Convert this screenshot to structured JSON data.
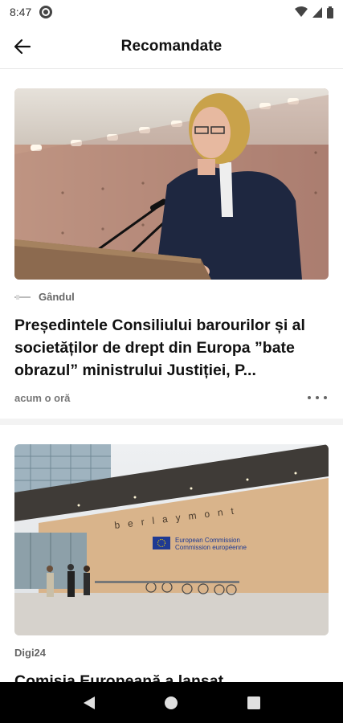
{
  "status_bar": {
    "time": "8:47",
    "icons": [
      "app-notification-icon",
      "wifi-icon",
      "cell-signal-icon",
      "battery-icon"
    ]
  },
  "header": {
    "title": "Recomandate",
    "back_icon": "arrow-left-icon"
  },
  "articles": [
    {
      "source": "Gândul",
      "headline": "Președintele Consiliului barourilor și al societăților de drept din Europa ”bate obrazul” ministrului Justiției, P...",
      "time_ago": "acum o oră",
      "image_subject": "woman-speaking-at-podium"
    },
    {
      "source": "Digi24",
      "headline": "Comisia Europeană a lansat",
      "image_subject": "european-commission-building",
      "image_texts": [
        "berlaymont",
        "European Commission",
        "Commission européenne"
      ]
    }
  ],
  "nav": {
    "back_icon": "triangle-back-icon",
    "home_icon": "circle-home-icon",
    "recents_icon": "square-recents-icon"
  },
  "colors": {
    "nav_bar": "#000000",
    "card_bg": "#ffffff",
    "feed_bg": "#f3f3f3",
    "source_text": "#666666",
    "eu_blue": "#1f3a93"
  }
}
